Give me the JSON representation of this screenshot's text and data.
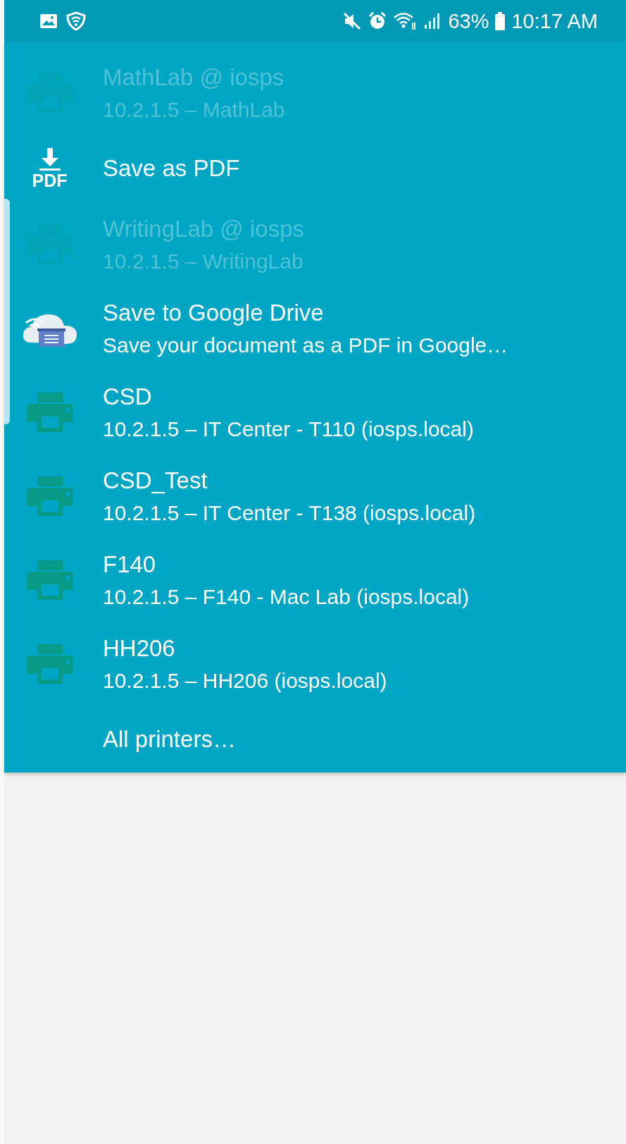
{
  "status_bar": {
    "battery": "63%",
    "time": "10:17 AM"
  },
  "menu": {
    "items": [
      {
        "kind": "printer",
        "title": "MathLab @ iosps",
        "subtitle": "10.2.1.5 – MathLab",
        "disabled": true
      },
      {
        "kind": "pdf",
        "icon_label": "PDF",
        "title": "Save as PDF",
        "disabled": false
      },
      {
        "kind": "printer",
        "title": "WritingLab @ iosps",
        "subtitle": "10.2.1.5 – WritingLab",
        "disabled": true
      },
      {
        "kind": "drive",
        "title": "Save to Google Drive",
        "subtitle": "Save your document as a PDF in Google…",
        "disabled": false
      },
      {
        "kind": "printer",
        "title": "CSD",
        "subtitle": "10.2.1.5 – IT Center - T110 (iosps.local)",
        "disabled": false
      },
      {
        "kind": "printer",
        "title": "CSD_Test",
        "subtitle": "10.2.1.5 – IT Center - T138 (iosps.local)",
        "disabled": false
      },
      {
        "kind": "printer",
        "title": "F140",
        "subtitle": "10.2.1.5 – F140 - Mac Lab (iosps.local)",
        "disabled": false
      },
      {
        "kind": "printer",
        "title": "HH206",
        "subtitle": "10.2.1.5 – HH206 (iosps.local)",
        "disabled": false
      },
      {
        "kind": "link",
        "title": "All printers…",
        "disabled": false
      }
    ]
  }
}
